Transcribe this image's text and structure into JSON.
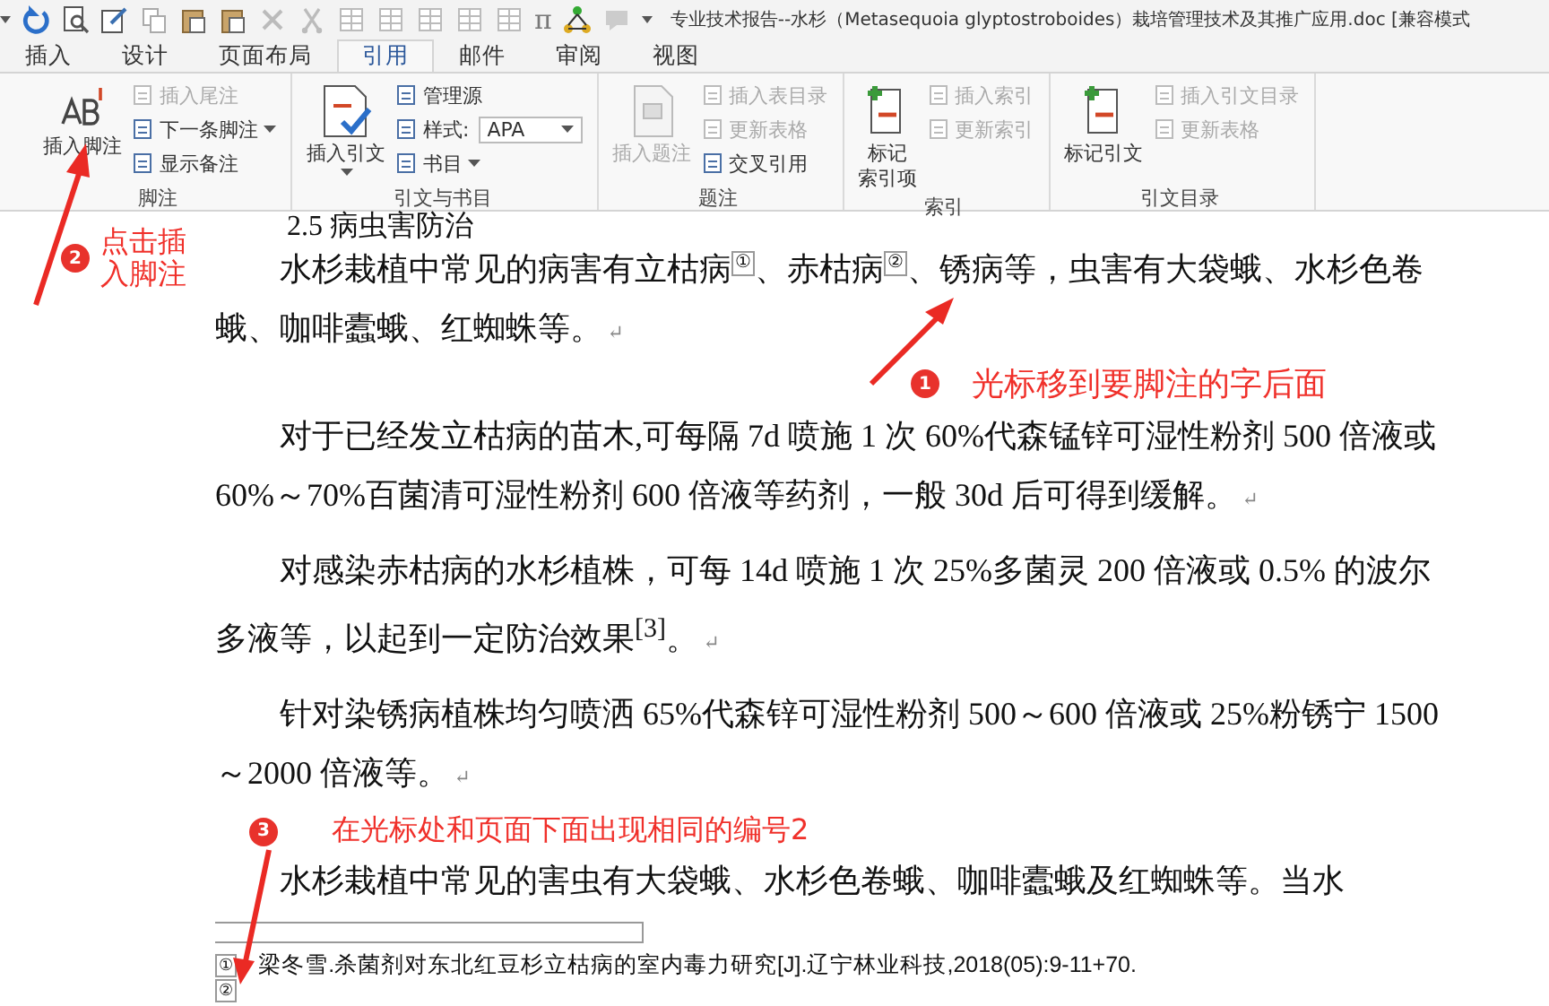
{
  "window": {
    "title": "专业技术报告--水杉（Metasequoia glyptostroboides）栽培管理技术及其推广应用.doc [兼容模式"
  },
  "equation_button": "π",
  "tabs": [
    {
      "label": "插入",
      "selected": false
    },
    {
      "label": "设计",
      "selected": false
    },
    {
      "label": "页面布局",
      "selected": false
    },
    {
      "label": "引用",
      "selected": true
    },
    {
      "label": "邮件",
      "selected": false
    },
    {
      "label": "审阅",
      "selected": false
    },
    {
      "label": "视图",
      "selected": false
    }
  ],
  "ribbon_groups": [
    {
      "name": "脚注",
      "large": {
        "kind": "footnote",
        "label_lines": [
          "插入脚注"
        ],
        "disabled": false,
        "dropdown": false
      },
      "small": [
        {
          "kind": "button",
          "label": "插入尾注",
          "disabled": true,
          "dropdown": false
        },
        {
          "kind": "button",
          "label": "下一条脚注",
          "disabled": false,
          "dropdown": true
        },
        {
          "kind": "button",
          "label": "显示备注",
          "disabled": false,
          "dropdown": false
        }
      ]
    },
    {
      "name": "引文与书目",
      "large": {
        "kind": "citation",
        "label_lines": [
          "插入引文"
        ],
        "disabled": false,
        "dropdown": true
      },
      "small": [
        {
          "kind": "button",
          "label": "管理源",
          "disabled": false,
          "dropdown": false
        },
        {
          "kind": "select",
          "label": "样式:",
          "value": "APA",
          "disabled": false,
          "dropdown": true
        },
        {
          "kind": "button",
          "label": "书目",
          "disabled": false,
          "dropdown": true
        }
      ]
    },
    {
      "name": "题注",
      "large": {
        "kind": "caption",
        "label_lines": [
          "插入题注"
        ],
        "disabled": true,
        "dropdown": false
      },
      "small": [
        {
          "kind": "button",
          "label": "插入表目录",
          "disabled": true,
          "dropdown": false
        },
        {
          "kind": "button",
          "label": "更新表格",
          "disabled": true,
          "dropdown": false
        },
        {
          "kind": "button",
          "label": "交叉引用",
          "disabled": false,
          "dropdown": false
        }
      ]
    },
    {
      "name": "索引",
      "large": {
        "kind": "mark",
        "label_lines": [
          "标记",
          "索引项"
        ],
        "disabled": false,
        "dropdown": false
      },
      "small": [
        {
          "kind": "button",
          "label": "插入索引",
          "disabled": true,
          "dropdown": false
        },
        {
          "kind": "button",
          "label": "更新索引",
          "disabled": true,
          "dropdown": false
        }
      ]
    },
    {
      "name": "引文目录",
      "large": {
        "kind": "mark",
        "label_lines": [
          "标记引文"
        ],
        "disabled": false,
        "dropdown": false
      },
      "small": [
        {
          "kind": "button",
          "label": "插入引文目录",
          "disabled": true,
          "dropdown": false
        },
        {
          "kind": "button",
          "label": "更新表格",
          "disabled": true,
          "dropdown": false
        }
      ]
    }
  ],
  "document": {
    "heading": "2.5 病虫害防治",
    "paragraphs": [
      {
        "runs": [
          {
            "kind": "text",
            "text": "水杉栽植中常见的病害有立枯病"
          },
          {
            "kind": "note",
            "text": "①"
          },
          {
            "kind": "text",
            "text": "、赤枯病"
          },
          {
            "kind": "note",
            "text": "②"
          },
          {
            "kind": "text",
            "text": "、锈病等，虫害有大袋蛾、水杉色卷蛾、咖啡蠹蛾、红蜘蛛等。"
          }
        ],
        "end_mark": "↵"
      },
      {
        "runs": [
          {
            "kind": "text",
            "text": "对于已经发立枯病的苗木,可每隔 7d 喷施 1 次 60%代森锰锌可湿性粉剂 500 倍液或 60%～70%百菌清可湿性粉剂 600 倍液等药剂，一般 30d 后可得到缓解。"
          }
        ],
        "end_mark": "↵"
      },
      {
        "runs": [
          {
            "kind": "text",
            "text": "对感染赤枯病的水杉植株，可每 14d 喷施 1 次 25%多菌灵 200 倍液或 0.5% 的波尔多液等，以起到一定防治效果$^{[3]}$。"
          }
        ],
        "end_mark": "↵"
      },
      {
        "runs": [
          {
            "kind": "text",
            "text": "针对染锈病植株均匀喷洒 65%代森锌可湿性粉剂 500～600 倍液或 25%粉锈宁 1500～2000 倍液等。"
          }
        ],
        "end_mark": "↵"
      },
      {
        "runs": [
          {
            "kind": "text",
            "text": "水杉栽植中常见的害虫有大袋蛾、水杉色卷蛾、咖啡蠹蛾及红蜘蛛等。当水"
          }
        ]
      }
    ],
    "footnotes": [
      {
        "mark": "①",
        "text": "梁冬雪.杀菌剂对东北红豆杉立枯病的室内毒力研究[J].辽宁林业科技,2018(05):9-11+70."
      },
      {
        "mark": "②"
      }
    ]
  },
  "annotations": [
    {
      "number": "2",
      "text": "点击插入脚注"
    },
    {
      "number": "1",
      "text": "光标移到要脚注的字后面"
    },
    {
      "number": "3",
      "text": "在光标处和页面下面出现相同的编号2"
    }
  ]
}
